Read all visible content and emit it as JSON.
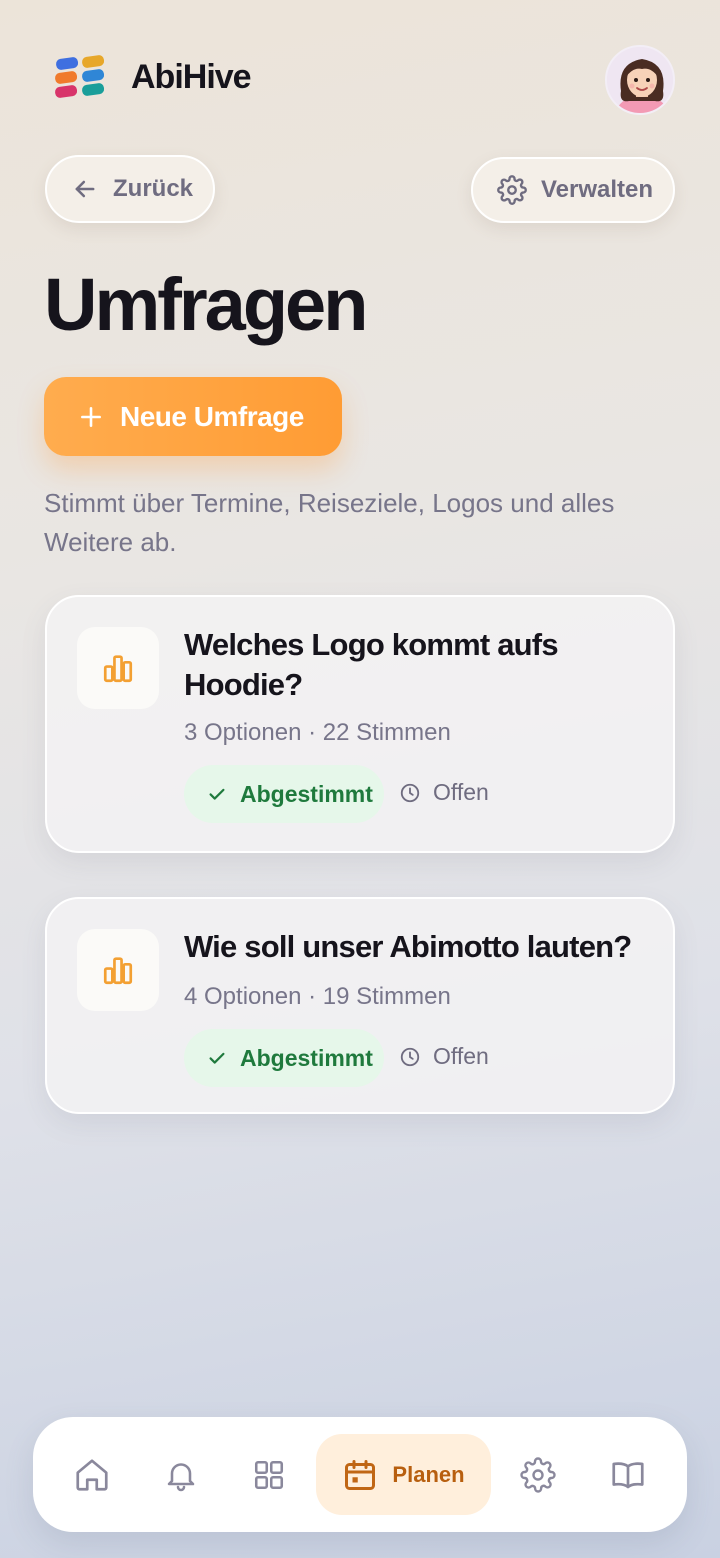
{
  "app": {
    "name": "AbiHive"
  },
  "header": {
    "back_label": "Zurück",
    "manage_label": "Verwalten"
  },
  "page": {
    "title": "Umfragen",
    "new_button_label": "Neue Umfrage",
    "description": "Stimmt über Termine, Reiseziele, Logos und alles Weitere ab."
  },
  "polls": [
    {
      "title": "Welches Logo kommt aufs Hoodie?",
      "meta": "3 Optionen · 22 Stimmen",
      "badge": "Abgestimmt",
      "status": "Offen"
    },
    {
      "title": "Wie soll unser Abimotto lauten?",
      "meta": "4 Optionen · 19 Stimmen",
      "badge": "Abgestimmt",
      "status": "Offen"
    }
  ],
  "nav": {
    "items": [
      {
        "icon": "home-icon"
      },
      {
        "icon": "bell-icon"
      },
      {
        "icon": "grid-icon"
      },
      {
        "icon": "calendar-icon",
        "label": "Planen",
        "active": true
      },
      {
        "icon": "gear-icon"
      },
      {
        "icon": "book-icon"
      }
    ]
  },
  "colors": {
    "accent": "#ff9c34",
    "active_nav_bg": "#ffefdc",
    "active_nav_text": "#b85f0f",
    "success_bg": "#e6f7ea",
    "success_text": "#1f7a3d"
  }
}
